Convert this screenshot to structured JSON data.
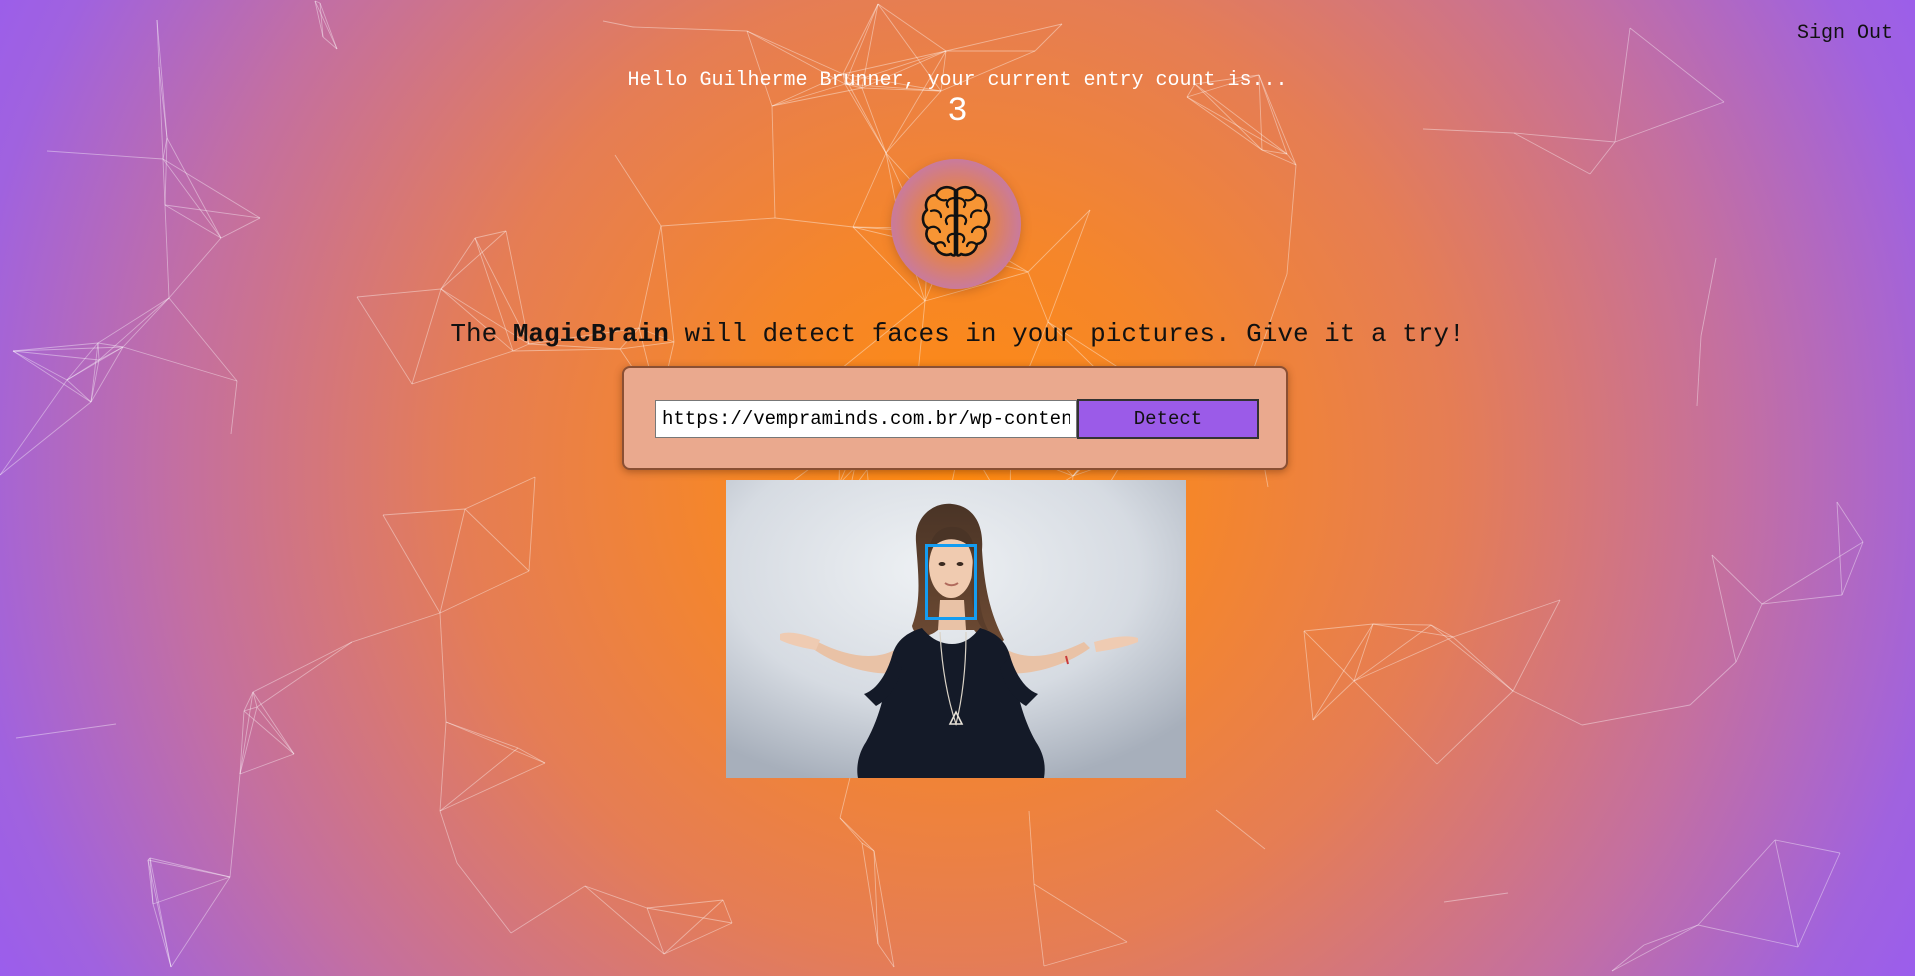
{
  "header": {
    "sign_out_label": "Sign Out"
  },
  "rank": {
    "greeting": "Hello Guilherme Brunner, your current entry count is...",
    "count": "3"
  },
  "logo": {
    "icon": "brain-icon"
  },
  "tagline": {
    "prefix": "The ",
    "brand": "MagicBrain",
    "suffix": " will detect faces in your pictures. Give it a try!"
  },
  "image_form": {
    "url_value": "https://vempraminds.com.br/wp-content/",
    "detect_label": "Detect"
  },
  "result": {
    "faces_detected": 1
  },
  "colors": {
    "accent": "#9b5be8",
    "face_box": "#149df2",
    "background_center": "#ff8a10",
    "background_edge": "#9558fb"
  }
}
